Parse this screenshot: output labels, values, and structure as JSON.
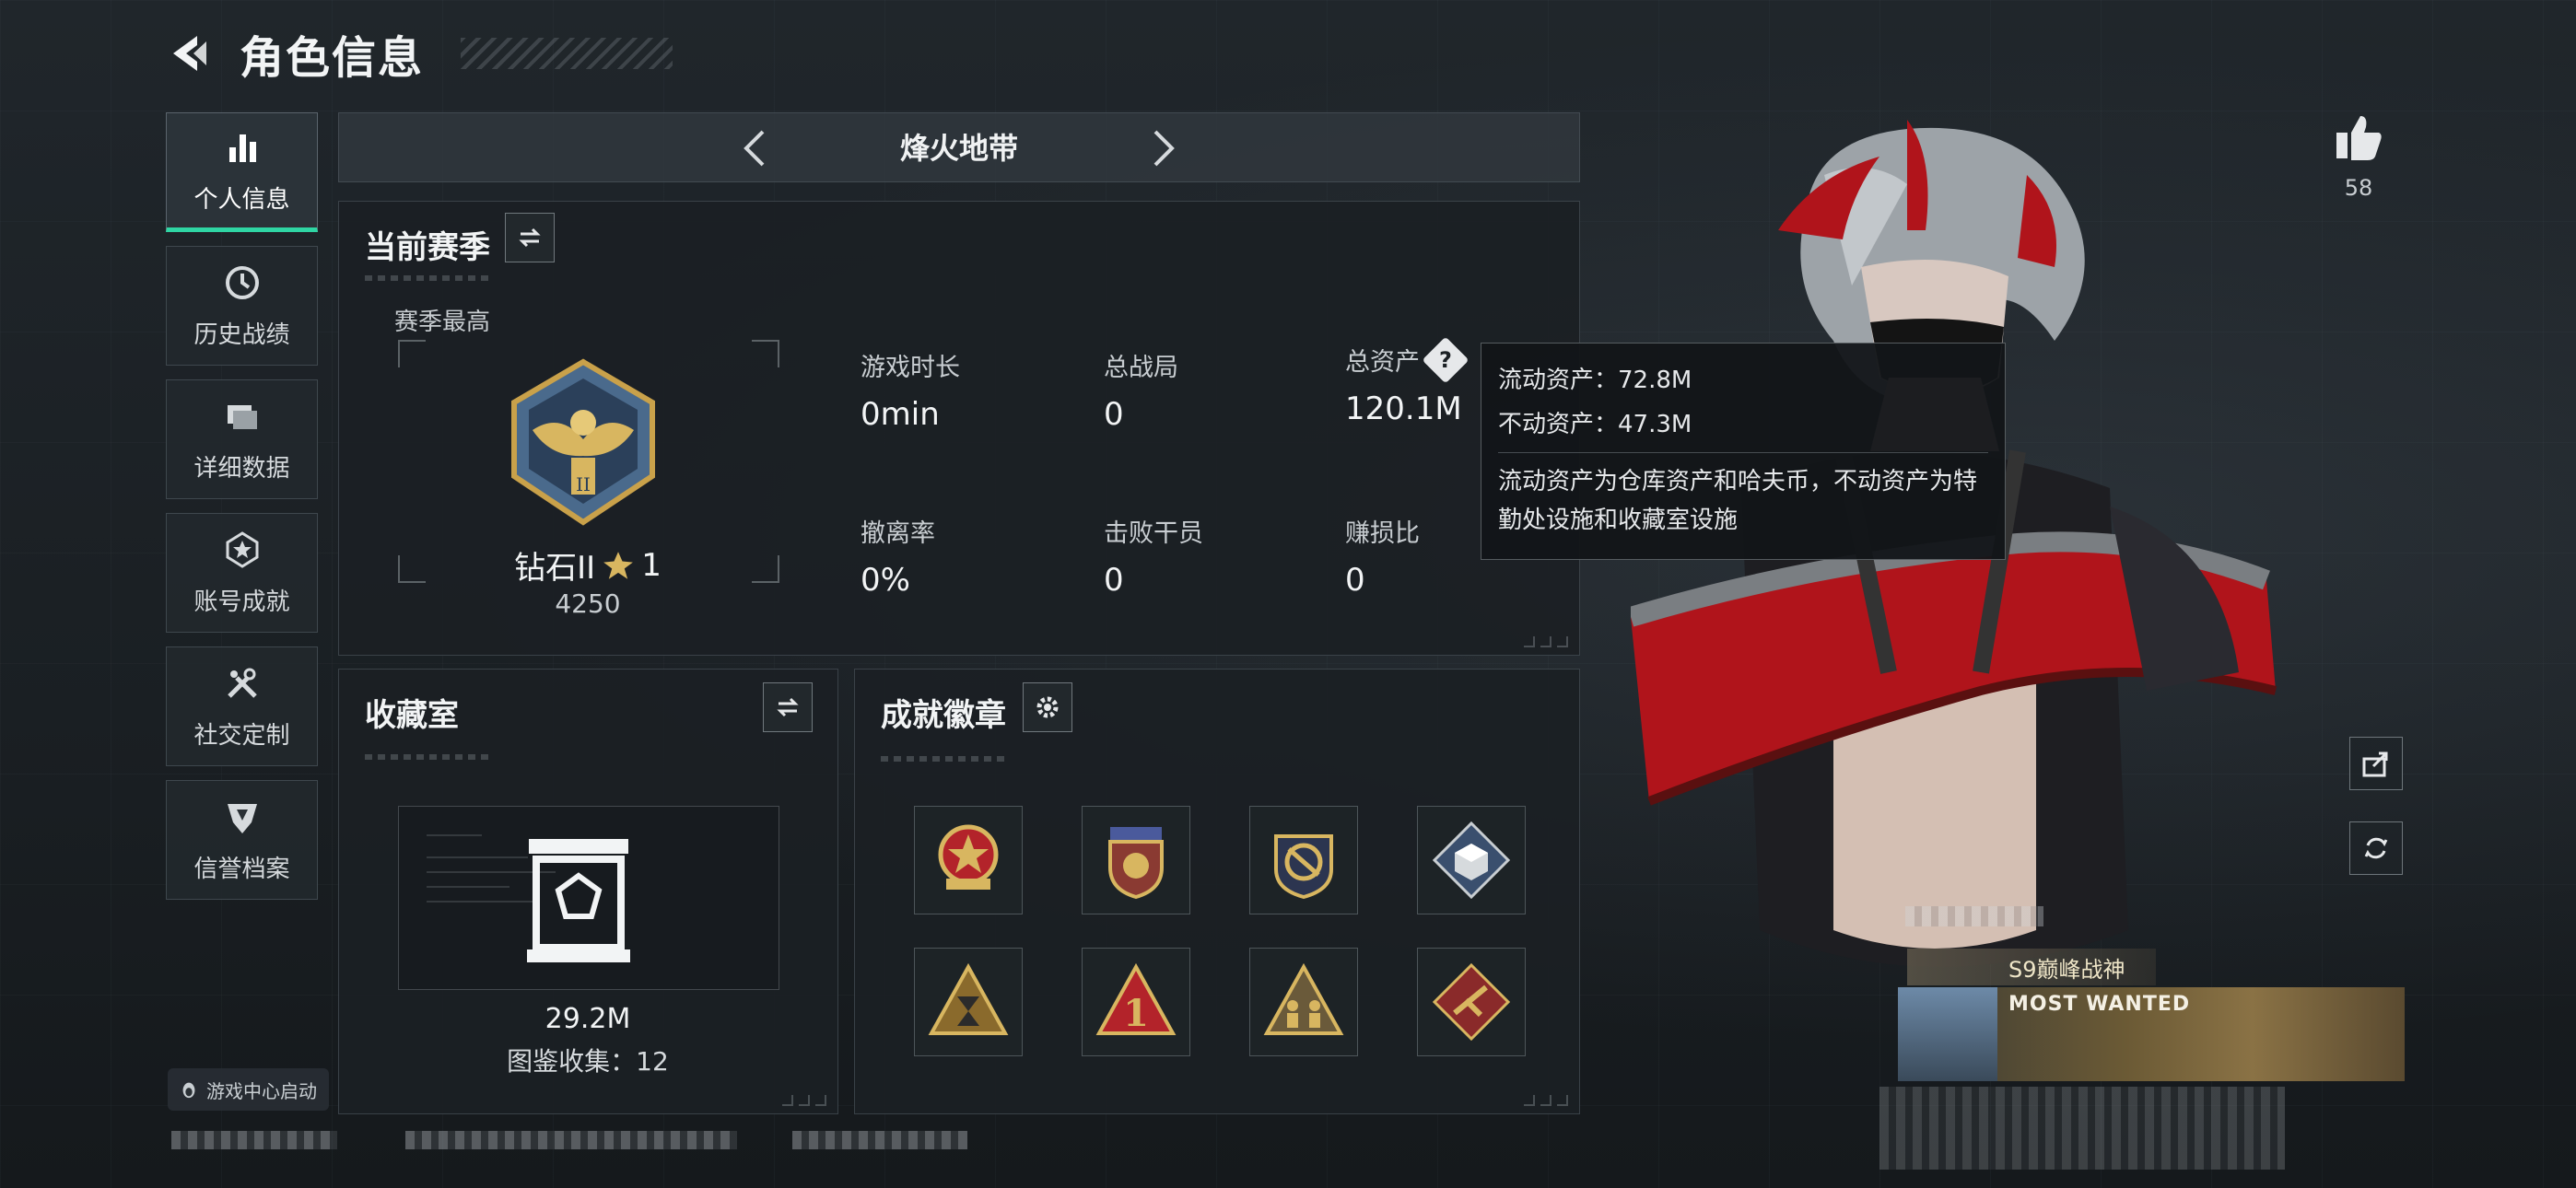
{
  "header": {
    "title": "角色信息"
  },
  "nav": {
    "items": [
      {
        "label": "个人信息",
        "icon": "bar-chart-icon",
        "active": true
      },
      {
        "label": "历史战绩",
        "icon": "clock-icon",
        "active": false
      },
      {
        "label": "详细数据",
        "icon": "folder-icon",
        "active": false
      },
      {
        "label": "账号成就",
        "icon": "achievement-icon",
        "active": false
      },
      {
        "label": "社交定制",
        "icon": "tools-icon",
        "active": false
      },
      {
        "label": "信誉档案",
        "icon": "shield-icon",
        "active": false
      }
    ],
    "game_launch": "游戏中心启动"
  },
  "mode": {
    "title": "烽火地带"
  },
  "season": {
    "title": "当前赛季",
    "best_label": "赛季最高",
    "rank_name": "钻石II",
    "rank_stars": "1",
    "rank_score": "4250",
    "stats": {
      "play_time": {
        "label": "游戏时长",
        "value": "0min"
      },
      "total_matches": {
        "label": "总战局",
        "value": "0"
      },
      "total_assets": {
        "label": "总资产",
        "value": "120.1M"
      },
      "extract_rate": {
        "label": "撤离率",
        "value": "0%"
      },
      "operators_defeated": {
        "label": "击败干员",
        "value": "0"
      },
      "profit_ratio": {
        "label": "赚损比",
        "value": "0"
      }
    }
  },
  "tooltip": {
    "liquid": "流动资产：72.8M",
    "fixed": "不动资产：47.3M",
    "description": "流动资产为仓库资产和哈夫币，不动资产为特勤处设施和收藏室设施"
  },
  "collection": {
    "title": "收藏室",
    "value": "29.2M",
    "count_text": "图鉴收集：12"
  },
  "achievements": {
    "title": "成就徽章",
    "badges": [
      "badge-star-medal",
      "badge-crown-shield",
      "badge-wrench-emblem",
      "badge-cube-diamond",
      "badge-hourglass-triangle",
      "badge-number-one-triangle",
      "badge-soldiers-triangle",
      "badge-wings-diamond"
    ]
  },
  "profile": {
    "likes": "58",
    "title_tag": "S9巅峰战神",
    "banner_text": "MOST WANTED"
  },
  "colors": {
    "accent": "#2fd6a4",
    "gold": "#c9a14a",
    "armor_red": "#b0141b"
  }
}
